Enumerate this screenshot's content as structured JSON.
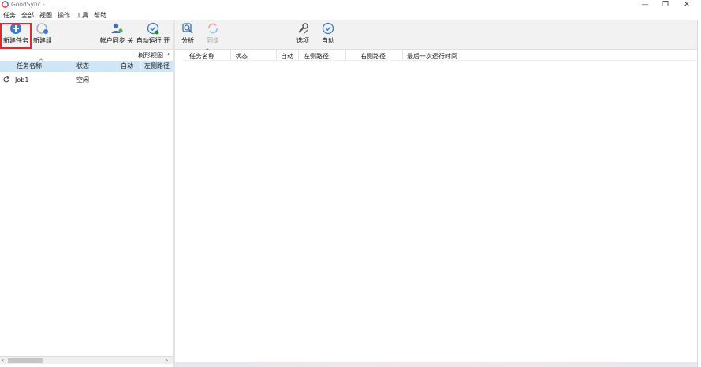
{
  "window": {
    "title": "GoodSync -",
    "controls": [
      "minimize-icon",
      "restore-icon",
      "close-icon"
    ]
  },
  "menu": [
    "任务",
    "全部",
    "视图",
    "操作",
    "工具",
    "帮助"
  ],
  "left_toolbar": {
    "new_job": "新建任务",
    "new_group": "新建组",
    "account_sync": "帐户同步 关",
    "auto_run": "自动运行 开"
  },
  "right_toolbar": {
    "analyze": "分析",
    "sync": "同步",
    "options": "选项",
    "auto": "自动"
  },
  "tree_view": {
    "label": "树形视图",
    "arrow": "‹"
  },
  "left_table": {
    "headers": [
      "任务名称",
      "状态",
      "自动",
      "左侧路径"
    ],
    "rows": [
      {
        "name": "Job1",
        "status": "空闲"
      }
    ]
  },
  "right_table": {
    "headers": [
      "任务名称",
      "状态",
      "自动",
      "左侧路径",
      "右侧路径",
      "最后一次运行时间"
    ]
  },
  "colors": {
    "header_bg": "#cfe6f7",
    "toolbar_bg": "#f2f2f2",
    "highlight": "#e02a2a",
    "accent_blue": "#3a7bd5"
  }
}
